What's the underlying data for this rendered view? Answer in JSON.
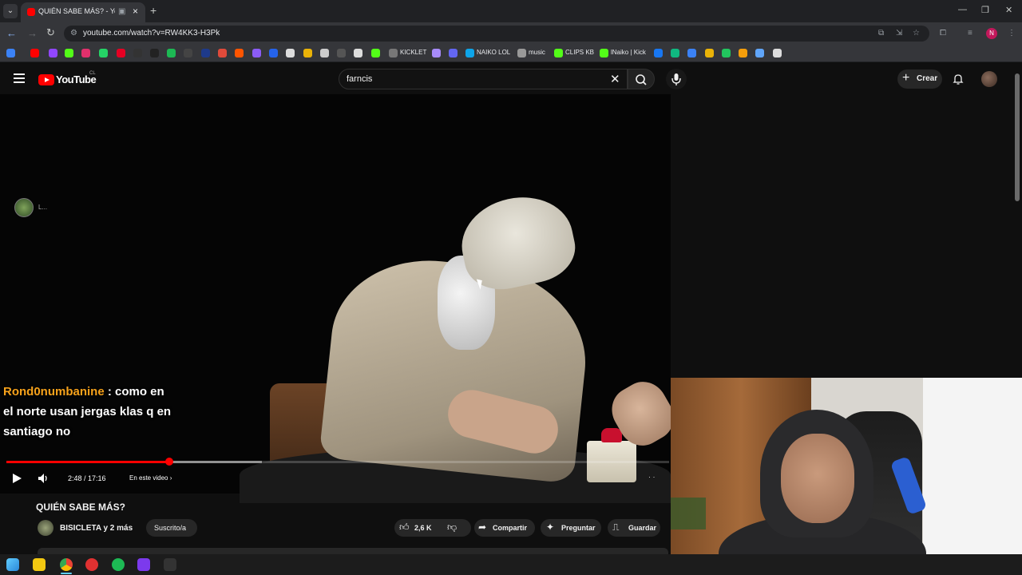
{
  "browser": {
    "tab_title": "QUIÉN SABE MÁS? - YouTube",
    "url": "youtube.com/watch?v=RW4KK3-H3Pk",
    "profile_initial": "N",
    "bookmarks": [
      "KICKLET",
      "NAIKO LOL",
      "music",
      "CLIPS KB",
      "lNaiko | Kick"
    ]
  },
  "youtube": {
    "logo": "YouTube",
    "country": "CL",
    "search": {
      "value": "farncis"
    },
    "create_label": "Crear"
  },
  "overlay": {
    "chat_avatar_label": "L...",
    "chat_user": "Rond0numbanine",
    "chat_text": " : como en el norte usan jergas klas q en santiago no"
  },
  "player": {
    "current_time": "2:48",
    "duration": "17:16",
    "time_display": "2:48 / 17:16",
    "chapter_label": "En este video",
    "progress_fraction": 0.246
  },
  "video": {
    "title": "QUIÉN SABE MÁS?",
    "channel": "BISICLETA y 2 más",
    "subscribed_label": "Suscrito/a",
    "likes": "2,6 K",
    "share_label": "Compartir",
    "ask_label": "Preguntar",
    "save_label": "Guardar"
  },
  "colors": {
    "accent": "#ff0000",
    "chat_user": "#f7a21b",
    "background": "#0f0f0f"
  }
}
